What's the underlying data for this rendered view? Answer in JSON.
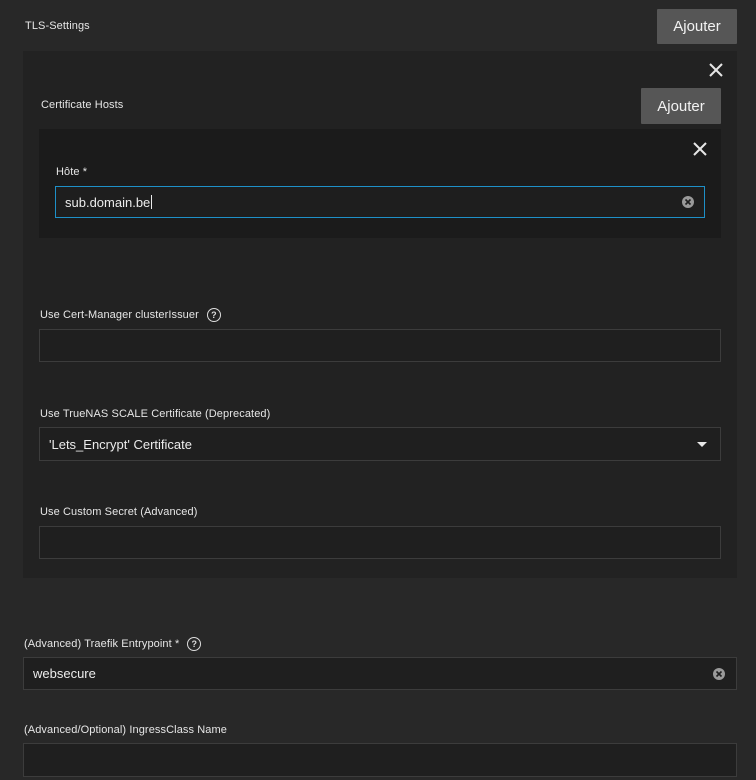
{
  "tls": {
    "section_label": "TLS-Settings",
    "add_label": "Ajouter",
    "certificate_hosts": {
      "label": "Certificate Hosts",
      "add_label": "Ajouter",
      "host_label": "Hôte *",
      "host_value": "sub.domain.be"
    },
    "cluster_issuer": {
      "label": "Use Cert-Manager clusterIssuer",
      "value": ""
    },
    "truenas_cert": {
      "label": "Use TrueNAS SCALE Certificate (Deprecated)",
      "value": "'Lets_Encrypt' Certificate"
    },
    "custom_secret": {
      "label": "Use Custom Secret (Advanced)",
      "value": ""
    }
  },
  "traefik": {
    "label": "(Advanced) Traefik Entrypoint *",
    "value": "websecure"
  },
  "ingress_class": {
    "label": "(Advanced/Optional) IngressClass Name",
    "value": ""
  },
  "icons": {
    "close": "close-icon",
    "clear": "clear-icon",
    "help": "help-icon",
    "dropdown": "chevron-down-icon"
  },
  "colors": {
    "background": "#282828",
    "focus_border": "#1e90c8",
    "button_bg": "#565656"
  }
}
